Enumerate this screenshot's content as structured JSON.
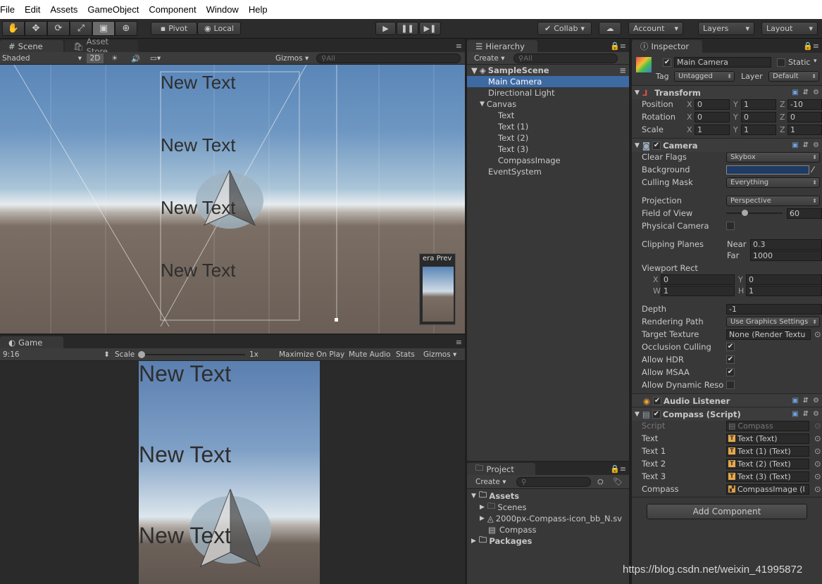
{
  "menu": [
    "File",
    "Edit",
    "Assets",
    "GameObject",
    "Component",
    "Window",
    "Help"
  ],
  "toolbar": {
    "pivot": "Pivot",
    "local": "Local",
    "collab": "Collab",
    "account": "Account",
    "layers": "Layers",
    "layout": "Layout"
  },
  "scene": {
    "tab": "Scene",
    "tab2": "Asset Store",
    "shading": "Shaded",
    "mode2d": "2D",
    "gizmos": "Gizmos",
    "search": "All",
    "texts": [
      "New Text",
      "New Text",
      "New Text",
      "New Text"
    ],
    "preview_label": "era Prev"
  },
  "game": {
    "tab": "Game",
    "aspect": "9:16",
    "scale": "Scale",
    "scale_val": "1x",
    "maximize": "Maximize On Play",
    "mute": "Mute Audio",
    "stats": "Stats",
    "gizmos": "Gizmos",
    "texts": [
      "New Text",
      "New Text",
      "New Text"
    ]
  },
  "hierarchy": {
    "tab": "Hierarchy",
    "create": "Create",
    "search": "All",
    "scene": "SampleScene",
    "items": [
      {
        "label": "Main Camera",
        "indent": 1,
        "selected": true
      },
      {
        "label": "Directional Light",
        "indent": 1
      },
      {
        "label": "Canvas",
        "indent": 1,
        "arrow": true
      },
      {
        "label": "Text",
        "indent": 2
      },
      {
        "label": "Text (1)",
        "indent": 2
      },
      {
        "label": "Text (2)",
        "indent": 2
      },
      {
        "label": "Text (3)",
        "indent": 2
      },
      {
        "label": "CompassImage",
        "indent": 2
      },
      {
        "label": "EventSystem",
        "indent": 1
      }
    ]
  },
  "project": {
    "tab": "Project",
    "create": "Create",
    "assets": "Assets",
    "scenes": "Scenes",
    "compass_svg": "2000px-Compass-icon_bb_N.sv",
    "compass": "Compass",
    "packages": "Packages"
  },
  "inspector": {
    "tab": "Inspector",
    "name": "Main Camera",
    "static": "Static",
    "tag_label": "Tag",
    "tag": "Untagged",
    "layer_label": "Layer",
    "layer": "Default",
    "transform": {
      "title": "Transform",
      "rows": [
        {
          "label": "Position",
          "x": "0",
          "y": "1",
          "z": "-10"
        },
        {
          "label": "Rotation",
          "x": "0",
          "y": "0",
          "z": "0"
        },
        {
          "label": "Scale",
          "x": "1",
          "y": "1",
          "z": "1"
        }
      ]
    },
    "camera": {
      "title": "Camera",
      "clear_flags": "Clear Flags",
      "clear_flags_val": "Skybox",
      "background": "Background",
      "background_color": "#1f3a63",
      "culling": "Culling Mask",
      "culling_val": "Everything",
      "projection": "Projection",
      "projection_val": "Perspective",
      "fov": "Field of View",
      "fov_val": "60",
      "physical": "Physical Camera",
      "clipping": "Clipping Planes",
      "near": "Near",
      "near_val": "0.3",
      "far": "Far",
      "far_val": "1000",
      "viewport": "Viewport Rect",
      "vx": "0",
      "vy": "0",
      "vw": "1",
      "vh": "1",
      "depth": "Depth",
      "depth_val": "-1",
      "rendering": "Rendering Path",
      "rendering_val": "Use Graphics Settings",
      "target": "Target Texture",
      "target_val": "None (Render Textu",
      "occlusion": "Occlusion Culling",
      "hdr": "Allow HDR",
      "msaa": "Allow MSAA",
      "dynres": "Allow Dynamic Reso"
    },
    "audio": {
      "title": "Audio Listener"
    },
    "compass": {
      "title": "Compass (Script)",
      "script": "Script",
      "script_val": "Compass",
      "rows": [
        {
          "label": "Text",
          "val": "Text (Text)"
        },
        {
          "label": "Text 1",
          "val": "Text (1) (Text)"
        },
        {
          "label": "Text 2",
          "val": "Text (2) (Text)"
        },
        {
          "label": "Text 3",
          "val": "Text (3) (Text)"
        }
      ],
      "compass_label": "Compass",
      "compass_val": "CompassImage (I"
    },
    "add_component": "Add Component"
  },
  "watermark": "https://blog.csdn.net/weixin_41995872"
}
